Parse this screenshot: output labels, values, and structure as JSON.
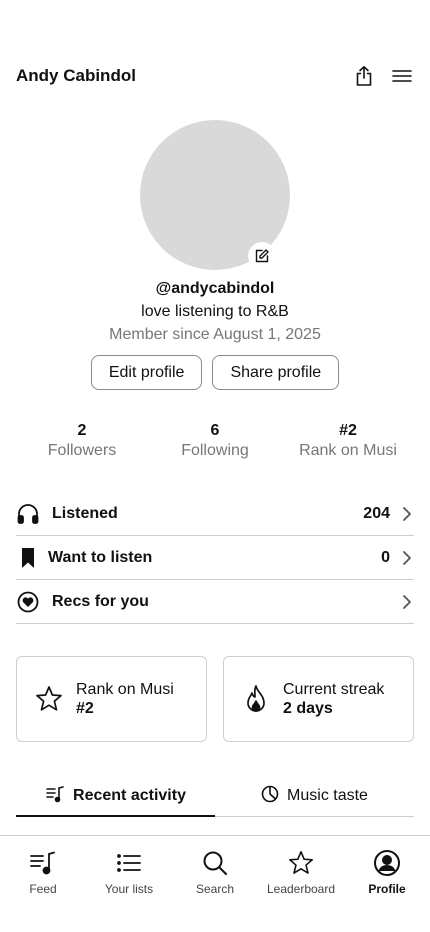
{
  "header": {
    "title": "Andy Cabindol",
    "share_icon": "share-icon",
    "menu_icon": "menu-icon"
  },
  "profile": {
    "username": "@andycabindol",
    "bio": "love listening to R&B",
    "member_since": "Member since August 1, 2025",
    "edit_button": "Edit profile",
    "share_button": "Share profile"
  },
  "stats": [
    {
      "value": "2",
      "label": "Followers"
    },
    {
      "value": "6",
      "label": "Following"
    },
    {
      "value": "#2",
      "label": "Rank on Musi"
    }
  ],
  "lists": [
    {
      "label": "Listened",
      "count": "204",
      "icon": "headphones-icon"
    },
    {
      "label": "Want to listen",
      "count": "0",
      "icon": "bookmark-icon"
    },
    {
      "label": "Recs for you",
      "count": "",
      "icon": "heart-circle-icon"
    }
  ],
  "cards": [
    {
      "label": "Rank on Musi",
      "value": "#2",
      "icon": "star-icon"
    },
    {
      "label": "Current streak",
      "value": "2 days",
      "icon": "flame-icon"
    }
  ],
  "tabs": [
    {
      "label": "Recent activity",
      "icon": "music-list-icon",
      "active": true
    },
    {
      "label": "Music taste",
      "icon": "pie-chart-icon",
      "active": false
    }
  ],
  "bottom_nav": [
    {
      "label": "Feed",
      "icon": "feed-icon",
      "active": false
    },
    {
      "label": "Your lists",
      "icon": "list-icon",
      "active": false
    },
    {
      "label": "Search",
      "icon": "search-icon",
      "active": false
    },
    {
      "label": "Leaderboard",
      "icon": "star-icon",
      "active": false
    },
    {
      "label": "Profile",
      "icon": "profile-icon",
      "active": true
    }
  ],
  "colors": {
    "text": "#111111",
    "muted": "#777777",
    "border": "#cfcfcf",
    "avatar_placeholder": "#d9d9d9"
  }
}
